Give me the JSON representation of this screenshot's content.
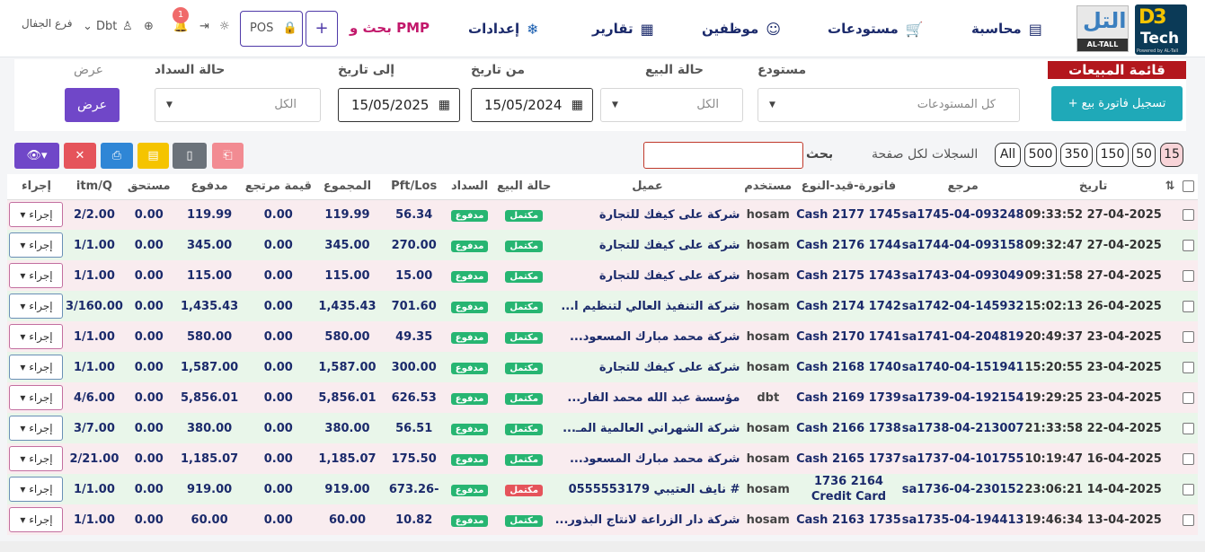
{
  "branch": "فرع الجفال",
  "user": "Dbt",
  "notifications": "1",
  "nav": {
    "accounting": "محاسبة",
    "warehouses": "مستودعات",
    "employees": "موظفين",
    "reports": "تقارير",
    "settings": "إعدادات",
    "search_pmp": "بحث و PMP",
    "pos": "POS",
    "plus": "+"
  },
  "logo": {
    "dbt_top": "D3",
    "dbt_bottom": "Tech",
    "powered": "Powered by AL-Tall",
    "tall_ar": "التل",
    "tall_en": "AL-TALL"
  },
  "page_title": "قائمة المبيعات",
  "register_button": "+ تسجيل فاتورة بيع",
  "filters": {
    "warehouse_label": "مستودع",
    "warehouse_value": "كل المستودعات",
    "sale_status_label": "حالة البيع",
    "sale_status_value": "الكل",
    "from_label": "من تاريخ",
    "from_value": "15/05/2024",
    "to_label": "إلى تاريخ",
    "to_value": "15/05/2025",
    "pay_status_label": "حالة السداد",
    "pay_status_value": "الكل",
    "show_label": "عرض",
    "show_button": "عرض"
  },
  "search_label": "بحث",
  "per_page_label": "السجلات لكل صفحة",
  "per_page_options": [
    "15",
    "50",
    "150",
    "350",
    "500",
    "All"
  ],
  "columns": [
    "تاريخ",
    "مرجع",
    "فاتورة-قيد-النوع",
    "مستخدم",
    "عميل",
    "حالة البيع",
    "السداد",
    "Pft/Los",
    "المجموع",
    "قيمة مرتجع",
    "مدفوع",
    "مستحق",
    "itm/Q",
    "إجراء"
  ],
  "rows": [
    {
      "date": "27-04-2025 09:33:52",
      "ref": "sa1745-04-093248",
      "inv": "Cash 2177 1745",
      "user": "hosam",
      "cust": "شركة على كيفك للتجارة",
      "sale": "مكتمل",
      "pay": "مدفوع",
      "pft": "56.34",
      "total": "119.99",
      "ret": "0.00",
      "paid": "119.99",
      "due": "0.00",
      "itm": "2/2.00",
      "act": "إجراء"
    },
    {
      "date": "27-04-2025 09:32:47",
      "ref": "sa1744-04-093158",
      "inv": "Cash 2176 1744",
      "user": "hosam",
      "cust": "شركة على كيفك للتجارة",
      "sale": "مكتمل",
      "pay": "مدفوع",
      "pft": "270.00",
      "total": "345.00",
      "ret": "0.00",
      "paid": "345.00",
      "due": "0.00",
      "itm": "1/1.00",
      "act": "إجراء"
    },
    {
      "date": "27-04-2025 09:31:58",
      "ref": "sa1743-04-093049",
      "inv": "Cash 2175 1743",
      "user": "hosam",
      "cust": "شركة على كيفك للتجارة",
      "sale": "مكتمل",
      "pay": "مدفوع",
      "pft": "15.00",
      "total": "115.00",
      "ret": "0.00",
      "paid": "115.00",
      "due": "0.00",
      "itm": "1/1.00",
      "act": "إجراء"
    },
    {
      "date": "26-04-2025 15:02:13",
      "ref": "sa1742-04-145932",
      "inv": "Cash 2174 1742",
      "user": "hosam",
      "cust": "شركة التنفيذ العالي لتنظيم ا...",
      "sale": "مكتمل",
      "pay": "مدفوع",
      "pft": "701.60",
      "total": "1,435.43",
      "ret": "0.00",
      "paid": "1,435.43",
      "due": "0.00",
      "itm": "3/160.00",
      "act": "إجراء"
    },
    {
      "date": "23-04-2025 20:49:37",
      "ref": "sa1741-04-204819",
      "inv": "Cash 2170 1741",
      "user": "hosam",
      "cust": "شركة محمد مبارك المسعود...",
      "sale": "مكتمل",
      "pay": "مدفوع",
      "pft": "49.35",
      "total": "580.00",
      "ret": "0.00",
      "paid": "580.00",
      "due": "0.00",
      "itm": "1/1.00",
      "act": "إجراء"
    },
    {
      "date": "23-04-2025 15:20:55",
      "ref": "sa1740-04-151941",
      "inv": "Cash 2168 1740",
      "user": "hosam",
      "cust": "شركة على كيفك للتجارة",
      "sale": "مكتمل",
      "pay": "مدفوع",
      "pft": "300.00",
      "total": "1,587.00",
      "ret": "0.00",
      "paid": "1,587.00",
      "due": "0.00",
      "itm": "1/1.00",
      "act": "إجراء"
    },
    {
      "date": "23-04-2025 19:29:25",
      "ref": "sa1739-04-192154",
      "inv": "Cash 2169 1739",
      "user": "dbt",
      "cust": "مؤسسة عبد الله محمد الفار...",
      "sale": "مكتمل",
      "pay": "مدفوع",
      "pft": "626.53",
      "total": "5,856.01",
      "ret": "0.00",
      "paid": "5,856.01",
      "due": "0.00",
      "itm": "4/6.00",
      "act": "إجراء"
    },
    {
      "date": "22-04-2025 21:33:58",
      "ref": "sa1738-04-213007",
      "inv": "Cash 2166 1738",
      "user": "hosam",
      "cust": "شركة الشهراني العالمية المـ...",
      "sale": "مكتمل",
      "pay": "مدفوع",
      "pft": "56.51",
      "total": "380.00",
      "ret": "0.00",
      "paid": "380.00",
      "due": "0.00",
      "itm": "3/7.00",
      "act": "إجراء"
    },
    {
      "date": "16-04-2025 10:19:47",
      "ref": "sa1737-04-101755",
      "inv": "Cash 2165 1737",
      "user": "hosam",
      "cust": "شركة محمد مبارك المسعود...",
      "sale": "مكتمل",
      "pay": "مدفوع",
      "pft": "175.50",
      "total": "1,185.07",
      "ret": "0.00",
      "paid": "1,185.07",
      "due": "0.00",
      "itm": "2/21.00",
      "act": "إجراء"
    },
    {
      "date": "14-04-2025 23:06:21",
      "ref": "sa1736-04-230152",
      "inv": "2164 1736",
      "inv2": "Credit Card",
      "user": "hosam",
      "cust": "# نايف العتيبي 0555553179",
      "sale": "مكتمل",
      "pay": "مدفوع",
      "pft": "-673.26",
      "total": "919.00",
      "ret": "0.00",
      "paid": "919.00",
      "due": "0.00",
      "itm": "1/1.00",
      "act": "إجراء",
      "sale_red": true
    },
    {
      "date": "13-04-2025 19:46:34",
      "ref": "sa1735-04-194413",
      "inv": "Cash 2163 1735",
      "user": "hosam",
      "cust": "شركة دار الزراعة لانتاج البذور...",
      "sale": "مكتمل",
      "pay": "مدفوع",
      "pft": "10.82",
      "total": "60.00",
      "ret": "0.00",
      "paid": "60.00",
      "due": "0.00",
      "itm": "1/1.00",
      "act": "إجراء"
    }
  ]
}
